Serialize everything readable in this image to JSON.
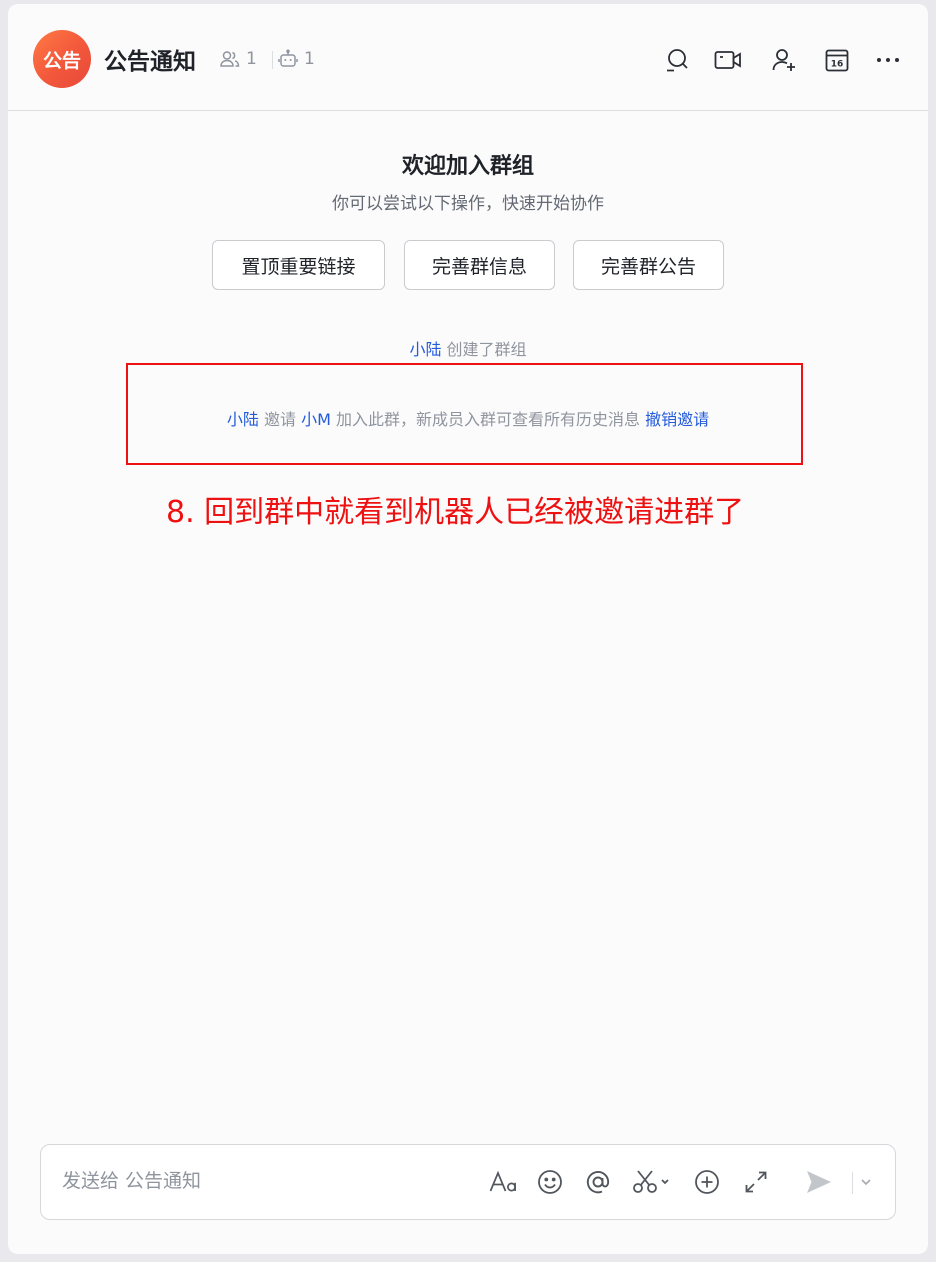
{
  "header": {
    "avatar_text": "公告",
    "title": "公告通知",
    "member_count": "1",
    "bot_count": "1",
    "calendar_day": "16"
  },
  "welcome": {
    "title": "欢迎加入群组",
    "subtitle": "你可以尝试以下操作，快速开始协作",
    "actions": [
      "置顶重要链接",
      "完善群信息",
      "完善群公告"
    ]
  },
  "system_messages": {
    "created": {
      "user": "小陆",
      "text": "创建了群组"
    },
    "invited": {
      "inviter": "小陆",
      "verb": "邀请",
      "invitee": "小M",
      "text": "加入此群，新成员入群可查看所有历史消息",
      "revoke_link": "撤销邀请"
    }
  },
  "annotation": "8. 回到群中就看到机器人已经被邀请进群了",
  "composer": {
    "placeholder": "发送给 公告通知"
  },
  "colors": {
    "accent_blue": "#245bdb",
    "annotation_red": "#ee1111",
    "avatar_orange": "#f2573b"
  }
}
